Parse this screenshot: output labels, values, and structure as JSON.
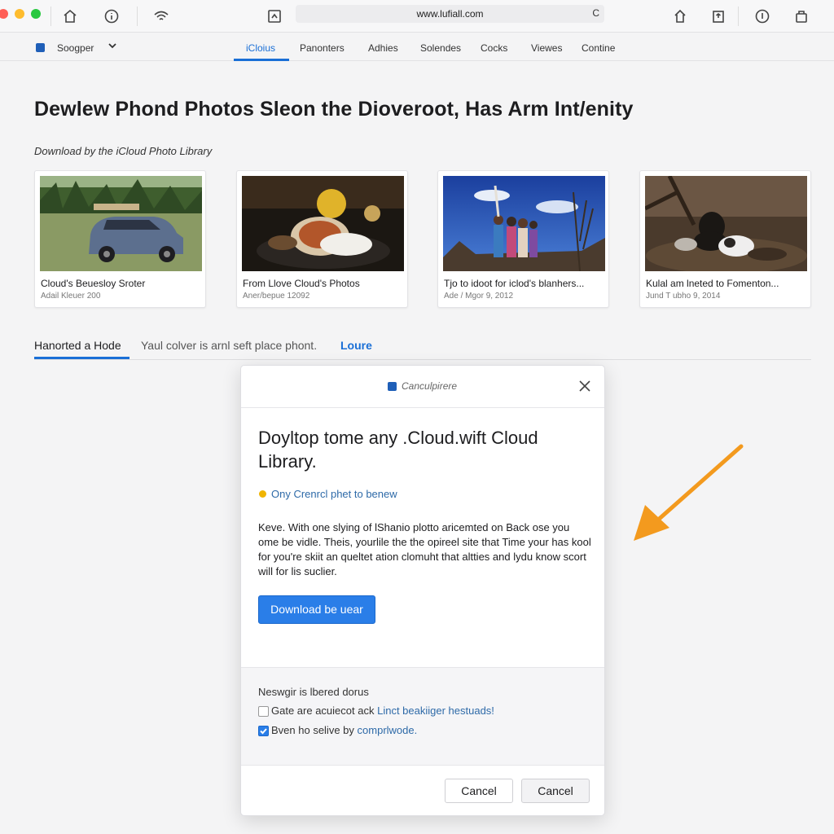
{
  "browser": {
    "url": "www.lufiall.com",
    "reload_glyph": "C",
    "traffic_colors": [
      "#ff5f57",
      "#febc2e",
      "#28c840"
    ]
  },
  "nav": {
    "account_label": "Soogper",
    "tabs": [
      "iCloius",
      "Panonters",
      "Adhies",
      "Solendes",
      "Cocks",
      "Viewes",
      "Contine"
    ],
    "active_tab": 0,
    "accent": "#1a6fd6"
  },
  "page": {
    "title": "Dewlew Phond Photos Sleon the Dioveroot, Has Arm Int/enity",
    "subtitle": "Download by the iCloud Photo Library"
  },
  "cards": [
    {
      "title": "Cloud's Beuesloy Sroter",
      "meta": "Adail Kleuer 200"
    },
    {
      "title": "From Llove Cloud's Photos",
      "meta": "Aner/bepue 12092"
    },
    {
      "title": "Tjo to idoot for iclod's blanhers...",
      "meta": "Ade / Mgor 9, 2012"
    },
    {
      "title": "Kulal am lneted to Fomenton...",
      "meta": "Jund T ubho 9, 2014"
    }
  ],
  "section": {
    "tab_label": "Hanorted a Hode",
    "text": "Yaul colver is arnl seft place phont.",
    "link": "Loure"
  },
  "dialog": {
    "header_title": "Canculpirere",
    "title": "Doyltop tome any .Cloud.wift Cloud Library.",
    "status": "Ony Crenrcl phet to benew",
    "body": "Keve. With one slying of lShanio plotto aricemted on Back ose you ome be vidle. Theis, yourlile the the opireel site that Time your has kool for you're skiit an queltet ation clomuht that altties and lydu know scort will for lis suclier.",
    "primary_button": "Download be uear",
    "options_heading": "Neswgir is lbered dorus",
    "options": [
      {
        "text": "Gate are acuiecot ack",
        "link": "Linct beakiiger hestuads!",
        "checked": false
      },
      {
        "text": "Bven ho selive by",
        "link": "comprlwode.",
        "checked": true
      }
    ],
    "buttons": [
      "Cancel",
      "Cancel"
    ]
  },
  "annotation": {
    "arrow_color": "#f39a1e"
  }
}
